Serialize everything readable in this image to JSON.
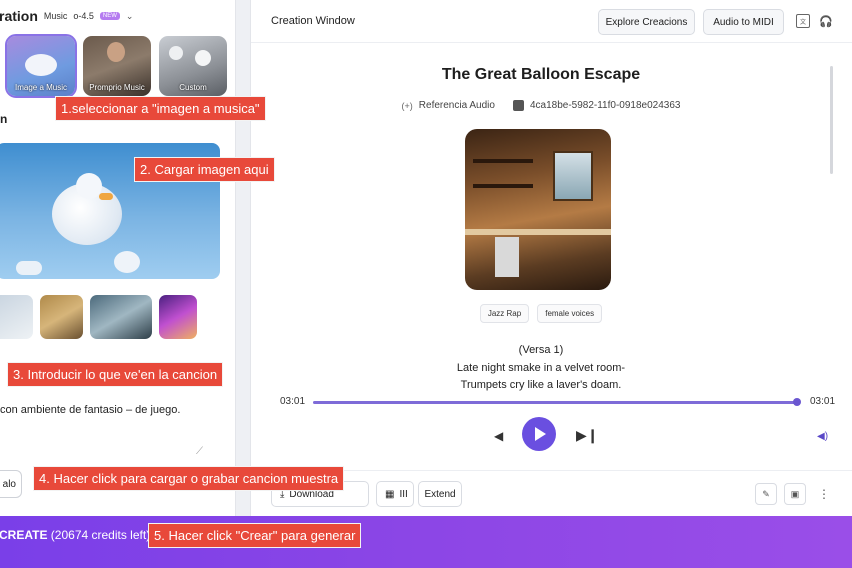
{
  "left_panel": {
    "title": "ration",
    "model": "Music",
    "version": "o-4.5",
    "badge": "NEW",
    "modes": [
      {
        "label": "Image a Music"
      },
      {
        "label": "Promprio Music"
      },
      {
        "label": "Custom"
      }
    ],
    "section_letter": "n",
    "prompt_text": "con ambiente de fantasio – de juego.",
    "sample_button": "alo"
  },
  "right_panel": {
    "title": "Creation Window",
    "header_buttons": [
      "Explore Creacions",
      "Audio to MIDI"
    ],
    "song_title": "The Great Balloon Escape",
    "reference_label": "Referencia Audio",
    "reference_prefix": "(+)",
    "song_id": "4ca18be-5982-11f0-0918e024363",
    "tags": [
      "Jazz Rap",
      "female voices"
    ],
    "lyrics": [
      "(Versa 1)",
      "Late night smake in a velvet room-",
      "Trumpets cry like a laver's doam."
    ],
    "time_current": "03:01",
    "time_total": "03:01",
    "progress": 1.0,
    "bottom_buttons": {
      "download": "Download",
      "midi": "III",
      "extend": "Extend"
    }
  },
  "create_bar": {
    "label": "CREATE",
    "credits": "(20674 credits left)"
  },
  "callouts": [
    "1.seleccionar a \"imagen a musica\"",
    "2. Cargar imagen aqui",
    "3. Introducir lo que ve'en la cancion",
    "4. Hacer click para cargar o grabar cancion muestra",
    "5. Hacer click \"Crear\" para generar"
  ]
}
